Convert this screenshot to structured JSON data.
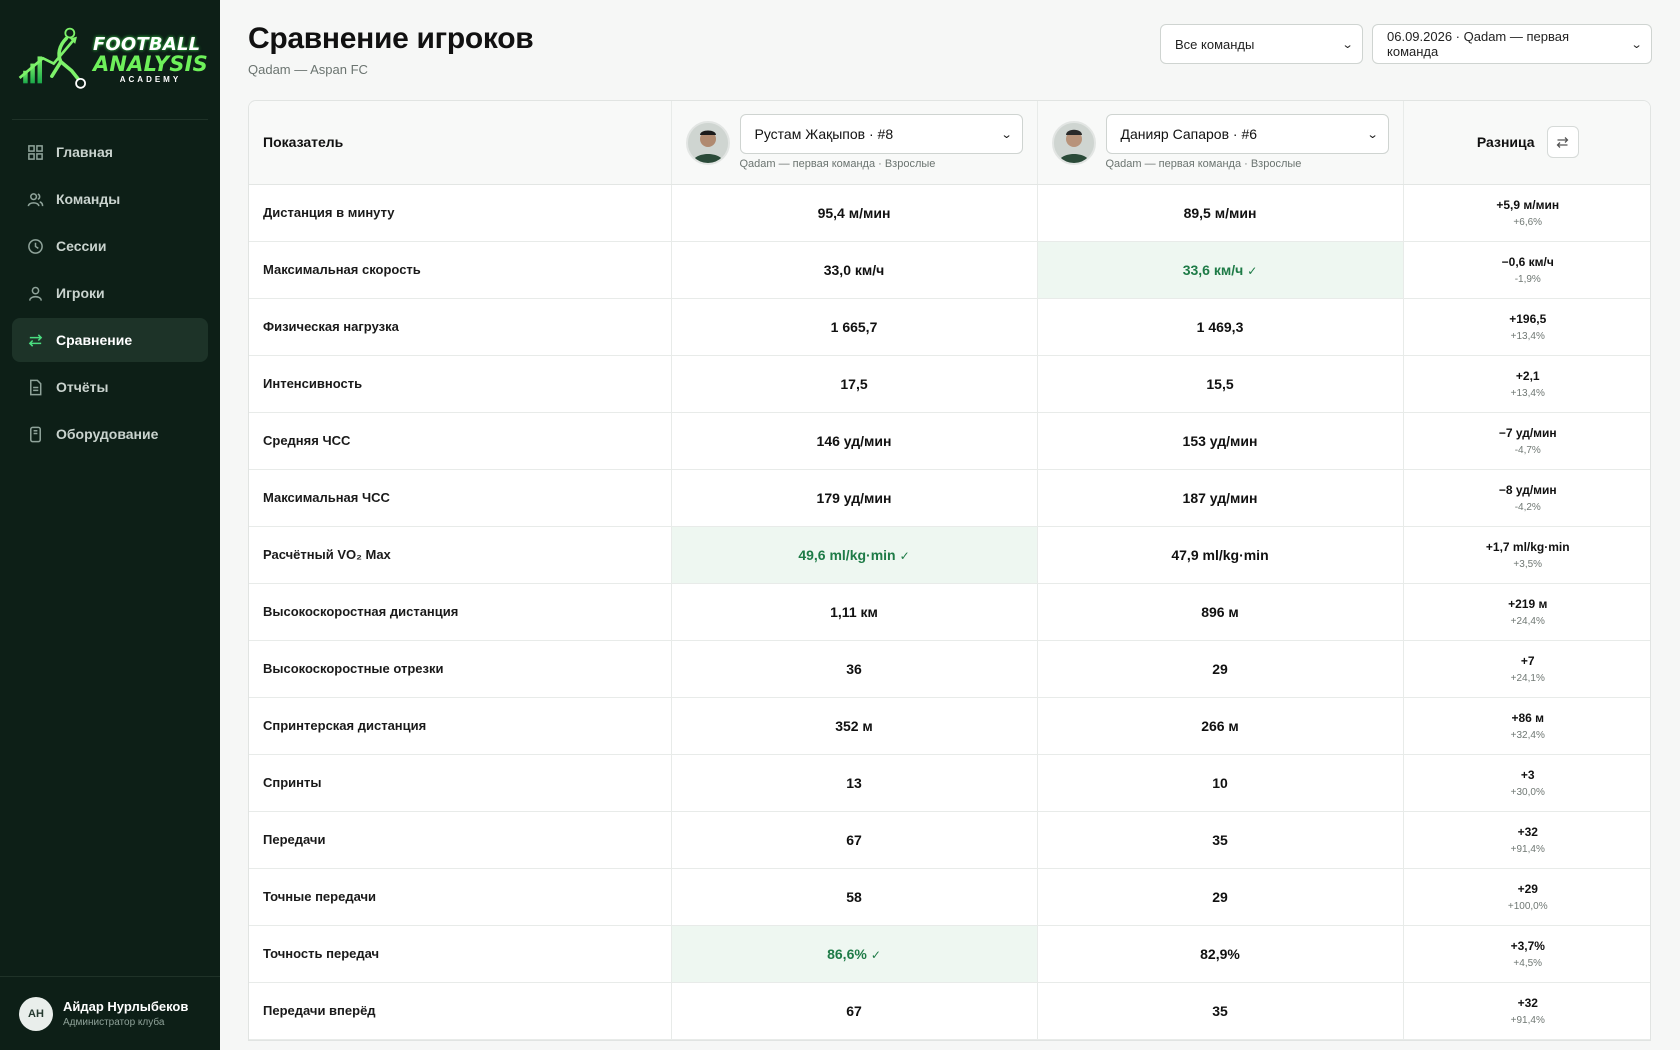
{
  "app": {
    "logo_line1": "FOOTBALL",
    "logo_line2": "ANALYSIS",
    "logo_line3": "ACADEMY"
  },
  "sidebar": {
    "items": [
      {
        "label": "Главная",
        "icon": "grid-icon"
      },
      {
        "label": "Команды",
        "icon": "users-icon"
      },
      {
        "label": "Сессии",
        "icon": "clock-icon"
      },
      {
        "label": "Игроки",
        "icon": "user-icon"
      },
      {
        "label": "Сравнение",
        "icon": "swap-icon",
        "active": true
      },
      {
        "label": "Отчёты",
        "icon": "document-icon"
      },
      {
        "label": "Оборудование",
        "icon": "device-icon"
      }
    ],
    "user": {
      "initials": "АН",
      "name": "Айдар Нурлыбеков",
      "role": "Администратор клуба"
    }
  },
  "header": {
    "title": "Сравнение игроков",
    "subtitle": "Qadam — Aspan FC",
    "team_filter": "Все команды",
    "session_filter": "06.09.2026 · Qadam — первая команда"
  },
  "table": {
    "metric_header": "Показатель",
    "diff_header": "Разница",
    "player1": {
      "name": "Рустам Жақыпов · #8",
      "meta": "Qadam — первая команда · Взрослые"
    },
    "player2": {
      "name": "Данияр Сапаров · #6",
      "meta": "Qadam — первая команда · Взрослые"
    },
    "rows": [
      {
        "metric": "Дистанция в минуту",
        "p1": "95,4 м/мин",
        "p2": "89,5 м/мин",
        "diff": "+5,9 м/мин",
        "pct": "+6,6%",
        "win": ""
      },
      {
        "metric": "Максимальная скорость",
        "p1": "33,0 км/ч",
        "p2": "33,6 км/ч",
        "diff": "−0,6 км/ч",
        "pct": "-1,9%",
        "win": "p2"
      },
      {
        "metric": "Физическая нагрузка",
        "p1": "1 665,7",
        "p2": "1 469,3",
        "diff": "+196,5",
        "pct": "+13,4%",
        "win": ""
      },
      {
        "metric": "Интенсивность",
        "p1": "17,5",
        "p2": "15,5",
        "diff": "+2,1",
        "pct": "+13,4%",
        "win": ""
      },
      {
        "metric": "Средняя ЧСС",
        "p1": "146 уд/мин",
        "p2": "153 уд/мин",
        "diff": "−7 уд/мин",
        "pct": "-4,7%",
        "win": ""
      },
      {
        "metric": "Максимальная ЧСС",
        "p1": "179 уд/мин",
        "p2": "187 уд/мин",
        "diff": "−8 уд/мин",
        "pct": "-4,2%",
        "win": ""
      },
      {
        "metric": "Расчётный VO₂ Max",
        "p1": "49,6 ml/kg·min",
        "p2": "47,9 ml/kg·min",
        "diff": "+1,7 ml/kg·min",
        "pct": "+3,5%",
        "win": "p1"
      },
      {
        "metric": "Высокоскоростная дистанция",
        "p1": "1,11 км",
        "p2": "896 м",
        "diff": "+219 м",
        "pct": "+24,4%",
        "win": ""
      },
      {
        "metric": "Высокоскоростные отрезки",
        "p1": "36",
        "p2": "29",
        "diff": "+7",
        "pct": "+24,1%",
        "win": ""
      },
      {
        "metric": "Спринтерская дистанция",
        "p1": "352 м",
        "p2": "266 м",
        "diff": "+86 м",
        "pct": "+32,4%",
        "win": ""
      },
      {
        "metric": "Спринты",
        "p1": "13",
        "p2": "10",
        "diff": "+3",
        "pct": "+30,0%",
        "win": ""
      },
      {
        "metric": "Передачи",
        "p1": "67",
        "p2": "35",
        "diff": "+32",
        "pct": "+91,4%",
        "win": ""
      },
      {
        "metric": "Точные передачи",
        "p1": "58",
        "p2": "29",
        "diff": "+29",
        "pct": "+100,0%",
        "win": ""
      },
      {
        "metric": "Точность передач",
        "p1": "86,6%",
        "p2": "82,9%",
        "diff": "+3,7%",
        "pct": "+4,5%",
        "win": "p1"
      },
      {
        "metric": "Передачи вперёд",
        "p1": "67",
        "p2": "35",
        "diff": "+32",
        "pct": "+91,4%",
        "win": ""
      }
    ],
    "win_mark": "✓"
  },
  "colors": {
    "sidebar_bg": "#0d1f17",
    "accent": "#4ade80",
    "win_bg": "#eef7f1",
    "win_text": "#1e7b47"
  }
}
